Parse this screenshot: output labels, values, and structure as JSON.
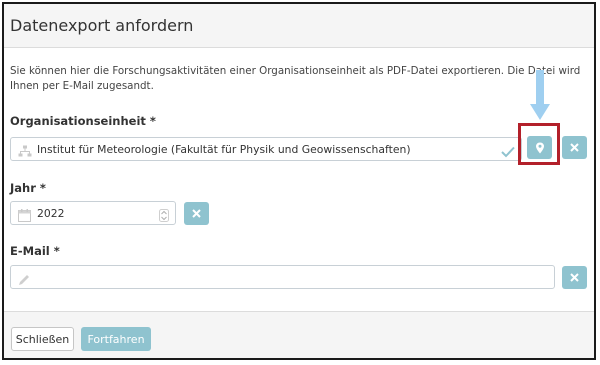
{
  "dialog": {
    "title": "Datenexport anfordern",
    "description": "Sie können hier die Forschungsaktivitäten einer Organisationseinheit als PDF-Datei exportieren. Die Datei wird Ihnen per E-Mail zugesandt."
  },
  "form": {
    "org_unit": {
      "label": "Organisationseinheit *",
      "value": "Institut für Meteorologie (Fakultät für Physik und Geowissenschaften)",
      "icon": "org-tree-icon"
    },
    "year": {
      "label": "Jahr *",
      "value": "2022",
      "icon": "calendar-icon"
    },
    "email": {
      "label": "E-Mail *",
      "value": "",
      "placeholder": "",
      "icon": "pencil-icon"
    }
  },
  "footer": {
    "close_label": "Schließen",
    "continue_label": "Fortfahren"
  },
  "colors": {
    "accent": "#8fc3cf",
    "highlight_box": "#b3202a",
    "arrow": "#9fcff0",
    "check": "#8fc3cf"
  }
}
